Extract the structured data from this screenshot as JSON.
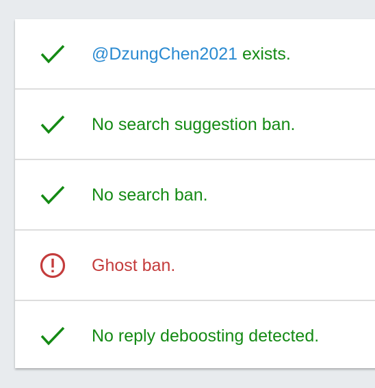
{
  "results": [
    {
      "status": "ok",
      "icon": "checkmark-icon",
      "handle": "@DzungChen2021",
      "text": " exists."
    },
    {
      "status": "ok",
      "icon": "checkmark-icon",
      "text": "No search suggestion ban."
    },
    {
      "status": "ok",
      "icon": "checkmark-icon",
      "text": "No search ban."
    },
    {
      "status": "bad",
      "icon": "alert-circle-icon",
      "text": "Ghost ban."
    },
    {
      "status": "ok",
      "icon": "checkmark-icon",
      "text": "No reply deboosting detected."
    }
  ],
  "colors": {
    "ok": "#148a14",
    "bad": "#c43c3c",
    "handle": "#2a8ad1",
    "background": "#e8ebee",
    "card": "#ffffff",
    "divider": "#dddddd"
  }
}
